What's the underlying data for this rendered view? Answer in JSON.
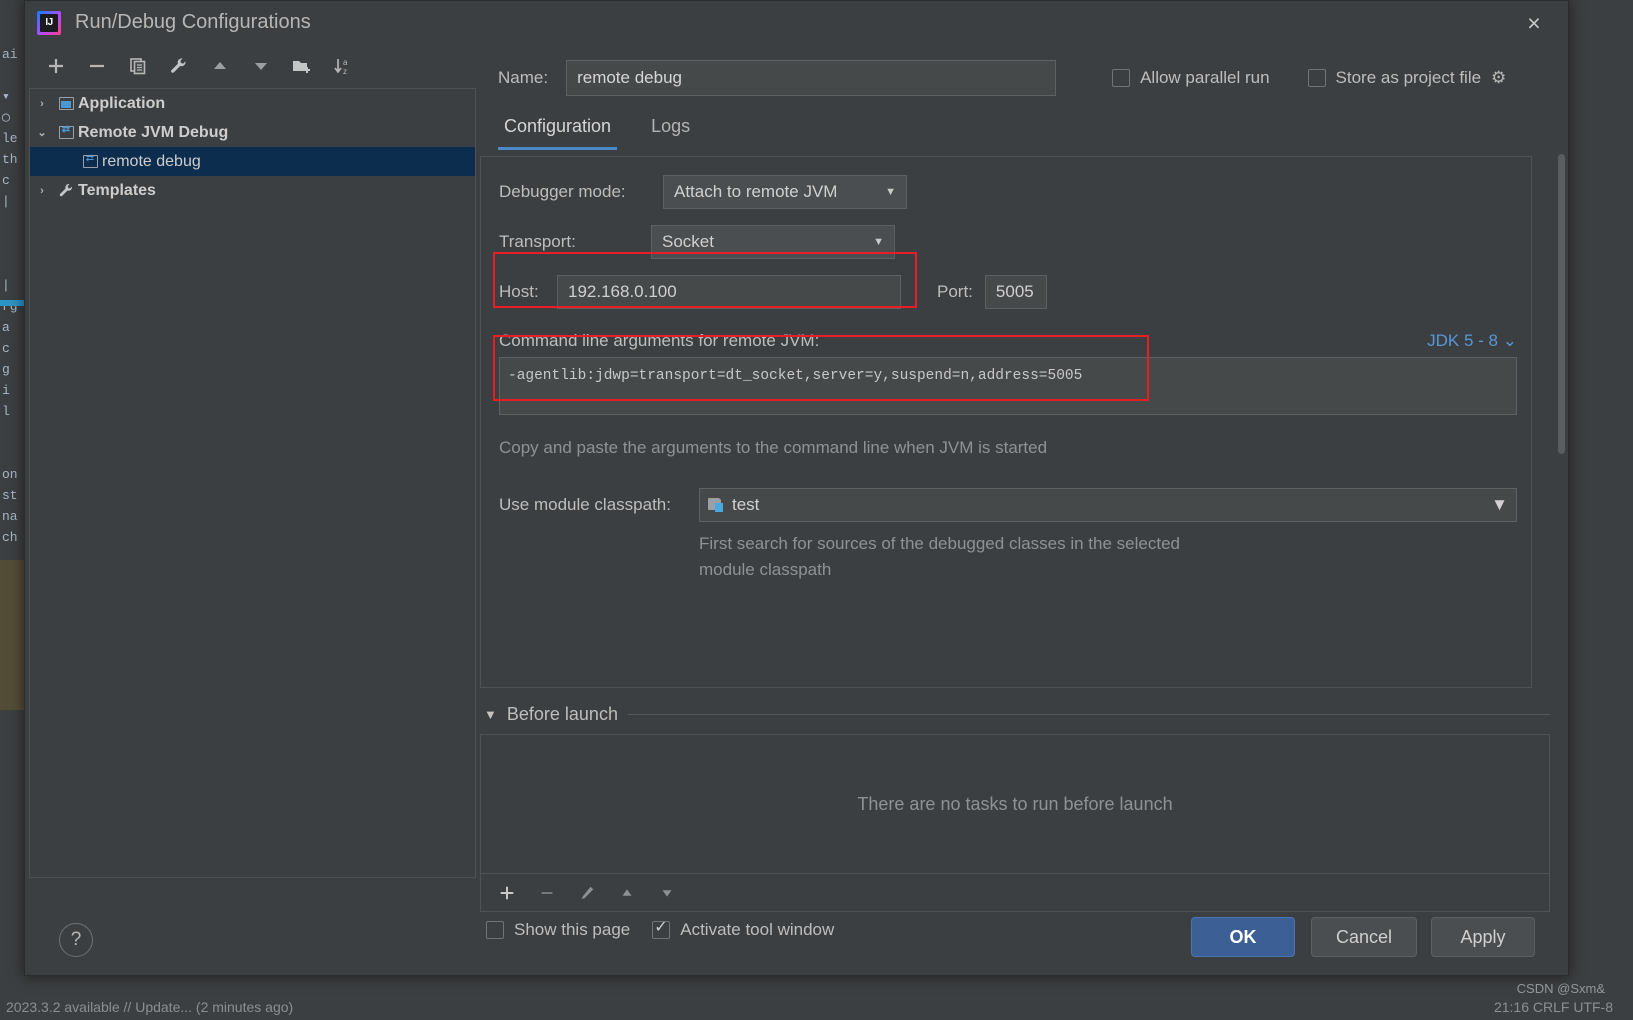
{
  "window": {
    "title": "Run/Debug Configurations",
    "logo_text": "IJ",
    "close_icon": "×"
  },
  "tree_toolbar": {
    "buttons": [
      {
        "name": "add-configuration",
        "glyph": "+"
      },
      {
        "name": "remove-configuration",
        "glyph": "−"
      },
      {
        "name": "copy-configuration",
        "glyph": "❐"
      },
      {
        "name": "edit-templates",
        "glyph": "🔧"
      },
      {
        "name": "move-up",
        "glyph": "▲"
      },
      {
        "name": "move-down",
        "glyph": "▼"
      },
      {
        "name": "new-folder",
        "glyph": "🗀"
      },
      {
        "name": "sort-alphabetically",
        "glyph": "↓az"
      }
    ]
  },
  "tree": {
    "items": [
      {
        "label": "Application",
        "twisty": "›",
        "icon": "application-icon",
        "depth": 0,
        "bold": true,
        "selected": false
      },
      {
        "label": "Remote JVM Debug",
        "twisty": "⌄",
        "icon": "remote-jvm-icon",
        "depth": 0,
        "bold": true,
        "selected": false
      },
      {
        "label": "remote debug",
        "twisty": "",
        "icon": "remote-jvm-icon",
        "depth": 1,
        "bold": false,
        "selected": true
      },
      {
        "label": "Templates",
        "twisty": "›",
        "icon": "wrench-icon",
        "depth": 0,
        "bold": true,
        "selected": false
      }
    ]
  },
  "name_row": {
    "label": "Name:",
    "value": "remote debug",
    "placeholder": "",
    "allow_parallel_run": {
      "label": "Allow parallel run",
      "checked": false
    },
    "store_as_project_file": {
      "label": "Store as project file",
      "checked": false
    },
    "gear_icon": "⚙"
  },
  "tabs": [
    {
      "label": "Configuration",
      "active": true
    },
    {
      "label": "Logs",
      "active": false
    }
  ],
  "configuration": {
    "debugger_mode": {
      "label": "Debugger mode:",
      "value": "Attach to remote JVM"
    },
    "transport": {
      "label": "Transport:",
      "value": "Socket"
    },
    "host": {
      "label": "Host:",
      "value": "192.168.0.100"
    },
    "port": {
      "label": "Port:",
      "value": "5005"
    },
    "args_title": "Command line arguments for remote JVM:",
    "jdk_selector": "JDK 5 - 8",
    "jdk_chevron": "⌄",
    "args_value": "-agentlib:jdwp=transport=dt_socket,server=y,suspend=n,address=5005",
    "args_hint": "Copy and paste the arguments to the command line when JVM is started",
    "module_classpath": {
      "label": "Use module classpath:",
      "value": "test"
    },
    "module_hint_line1": "First search for sources of the debugged classes in the selected",
    "module_hint_line2": "module classpath"
  },
  "before_launch": {
    "title": "Before launch",
    "collapse_icon": "▼",
    "empty_text": "There are no tasks to run before launch",
    "toolbar": [
      {
        "name": "add-task",
        "glyph": "+",
        "enabled": true
      },
      {
        "name": "remove-task",
        "glyph": "−",
        "enabled": false
      },
      {
        "name": "edit-task",
        "glyph": "✎",
        "enabled": false
      },
      {
        "name": "move-task-up",
        "glyph": "▲",
        "enabled": false
      },
      {
        "name": "move-task-down",
        "glyph": "▼",
        "enabled": false
      }
    ],
    "show_this_page": {
      "label": "Show this page",
      "checked": false
    },
    "activate_tool_window": {
      "label": "Activate tool window",
      "checked": true
    }
  },
  "footer": {
    "help_label": "?",
    "ok_label": "OK",
    "cancel_label": "Cancel",
    "apply_label": "Apply"
  },
  "ide_background": {
    "status_text": "2023.3.2 available // Update... (2 minutes ago)",
    "status_right": "21:16   CRLF   UTF-8",
    "left_fragments": [
      "ai",
      "▾",
      "()",
      "le",
      "th",
      ":",
      "|",
      "",
      "",
      "rg",
      "a",
      "c",
      "g",
      "i",
      "l",
      "",
      "on",
      "st",
      "na",
      "ch"
    ]
  },
  "watermark": "CSDN @Sxm&",
  "colors": {
    "accent": "#4a88c7",
    "highlight_red": "#e81e25",
    "ok_button": "#3c6096",
    "selection": "#0d2d4e",
    "link": "#5896d8"
  }
}
